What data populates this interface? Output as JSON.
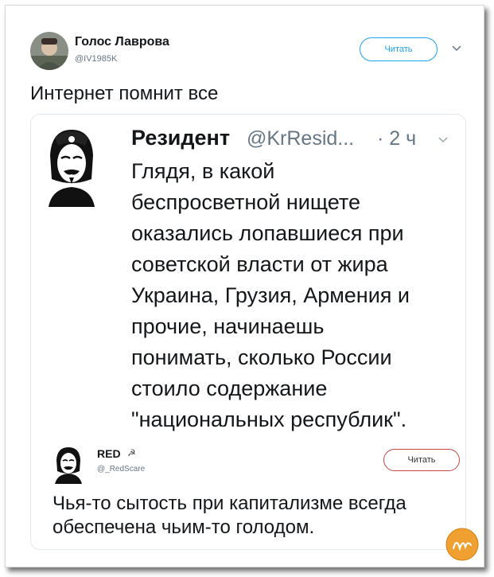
{
  "tweet": {
    "author_name": "Голос Лаврова",
    "author_handle": "@IV1985K",
    "follow_label": "Читать",
    "text": "Интернет помнит все"
  },
  "quoted": {
    "author_name": "Резидент",
    "author_handle": "@KrResid...",
    "time": "· 2 ч",
    "lines": [
      "Глядя, в какой",
      "беспросветной нищете",
      "оказались лопавшиеся при",
      "советской власти от жира",
      "Украина, Грузия, Армения и",
      "прочие, начинаешь",
      "понимать, сколько России",
      "стоило содержание",
      "\"национальных республик\"."
    ]
  },
  "reply": {
    "author_name": "RED",
    "verified_glyph": "☭",
    "author_handle": "@_RedScare",
    "follow_label": "Читать",
    "lines": [
      "Чья-то сытость при капитализме всегда",
      "обеспечена чьим-то голодом."
    ]
  },
  "icons": {
    "chevron": "chevron-down-icon",
    "watermark": "watermark-logo"
  },
  "colors": {
    "accent": "#1da1f2",
    "reply_button_border": "#cc4444",
    "watermark": "#f0a030"
  }
}
